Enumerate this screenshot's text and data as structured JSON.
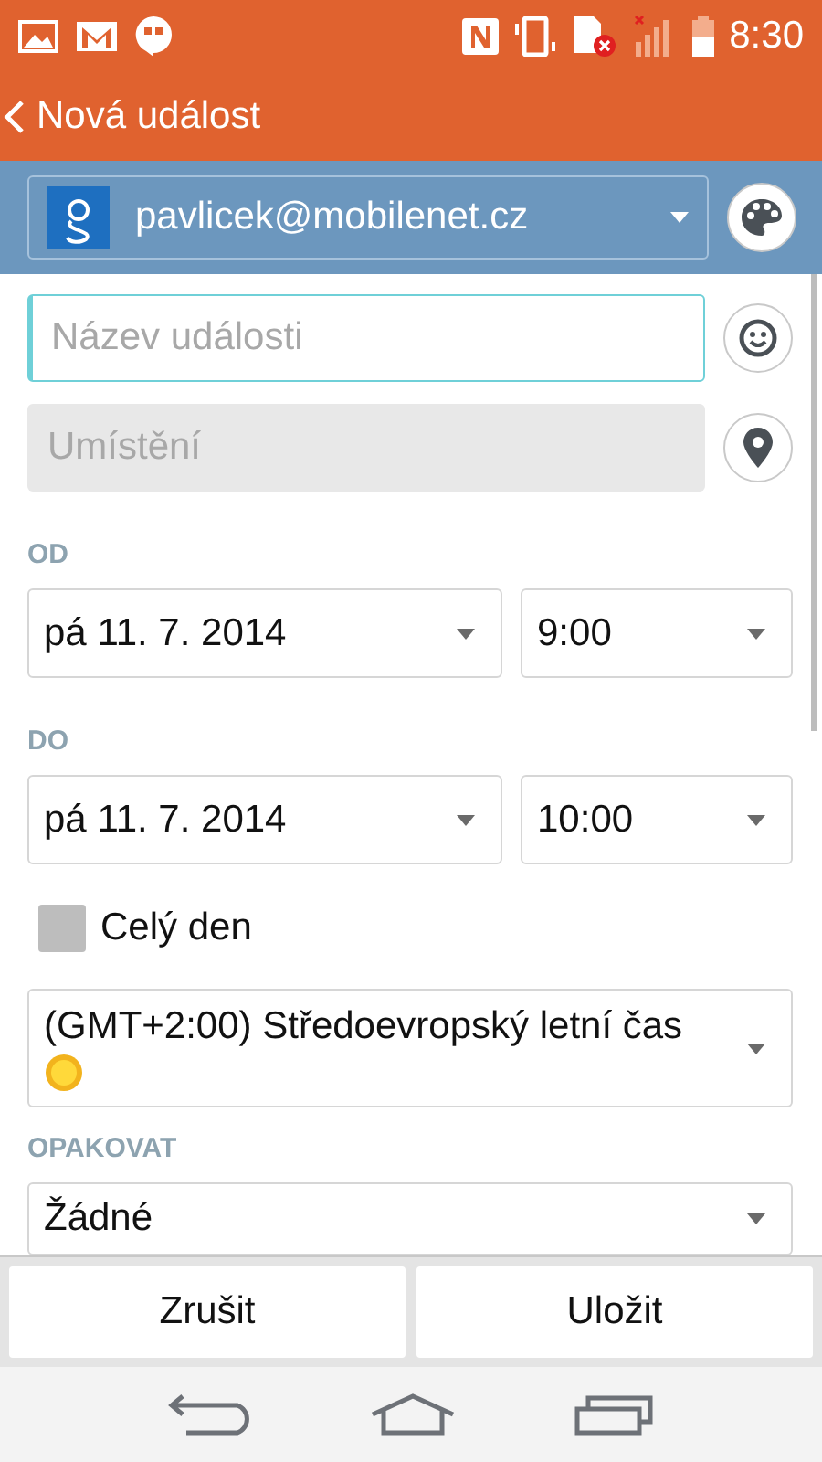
{
  "status_bar": {
    "time": "8:30"
  },
  "app_bar": {
    "title": "Nová událost"
  },
  "account": {
    "email": "pavlicek@mobilenet.cz"
  },
  "title_field": {
    "placeholder": "Název události",
    "focused": true
  },
  "location_field": {
    "placeholder": "Umístění",
    "disabled": true
  },
  "ranges": [
    {
      "label": "OD",
      "date": "pá 11. 7. 2014",
      "time": "9:00"
    },
    {
      "label": "DO",
      "date": "pá 11. 7. 2014",
      "time": "10:00"
    }
  ],
  "all_day": {
    "label": "Celý den",
    "checked": false
  },
  "timezone": {
    "value": "(GMT+2:00) Středoevropský letní čas"
  },
  "repeat": {
    "label": "OPAKOVAT",
    "value": "Žádné"
  },
  "buttons": [
    "Zrušit",
    "Uložit"
  ]
}
